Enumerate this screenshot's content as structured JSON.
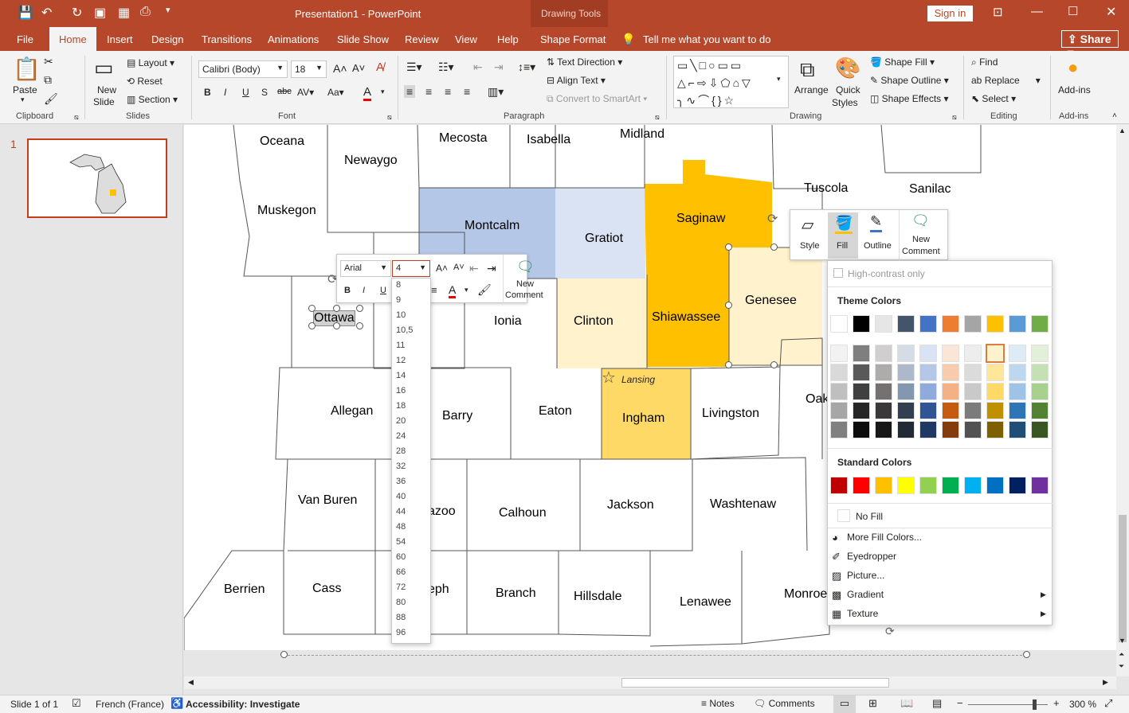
{
  "title": {
    "app": "Presentation1  -  PowerPoint",
    "drawing_tools": "Drawing Tools",
    "sign_in": "Sign in"
  },
  "tabs": [
    "File",
    "Home",
    "Insert",
    "Design",
    "Transitions",
    "Animations",
    "Slide Show",
    "Review",
    "View",
    "Help",
    "Shape Format"
  ],
  "tell_me": "Tell me what you want to do",
  "share": "Share",
  "ribbon": {
    "clipboard": {
      "group": "Clipboard",
      "paste": "Paste"
    },
    "slides": {
      "group": "Slides",
      "new_slide_1": "New",
      "new_slide_2": "Slide",
      "layout": "Layout",
      "reset": "Reset",
      "section": "Section"
    },
    "font": {
      "group": "Font",
      "name": "Calibri (Body)",
      "size": "18"
    },
    "paragraph": {
      "group": "Paragraph",
      "text_direction": "Text Direction",
      "align_text": "Align Text",
      "convert": "Convert to SmartArt"
    },
    "drawing": {
      "group": "Drawing",
      "arrange": "Arrange",
      "quick_1": "Quick",
      "quick_2": "Styles",
      "shape_fill": "Shape Fill",
      "shape_outline": "Shape Outline",
      "shape_effects": "Shape Effects"
    },
    "editing": {
      "group": "Editing",
      "find": "Find",
      "replace": "Replace",
      "select": "Select"
    },
    "addins": {
      "group": "Add-ins",
      "label": "Add-ins"
    }
  },
  "slide_number": "1",
  "counties": [
    {
      "name": "Oceana"
    },
    {
      "name": "Newaygo"
    },
    {
      "name": "Mecosta"
    },
    {
      "name": "Isabella"
    },
    {
      "name": "Midland"
    },
    {
      "name": "Tuscola"
    },
    {
      "name": "Sanilac"
    },
    {
      "name": "Muskegon"
    },
    {
      "name": "Montcalm"
    },
    {
      "name": "Gratiot"
    },
    {
      "name": "Saginaw"
    },
    {
      "name": "Ottawa"
    },
    {
      "name": "Ionia"
    },
    {
      "name": "Clinton"
    },
    {
      "name": "Shiawassee"
    },
    {
      "name": "Genesee"
    },
    {
      "name": "Allegan"
    },
    {
      "name": "Barry"
    },
    {
      "name": "Eaton"
    },
    {
      "name": "Ingham"
    },
    {
      "name": "Livingston"
    },
    {
      "name": "Oak"
    },
    {
      "name": "Van Buren"
    },
    {
      "name": "azoo"
    },
    {
      "name": "Calhoun"
    },
    {
      "name": "Jackson"
    },
    {
      "name": "Washtenaw"
    },
    {
      "name": "Berrien"
    },
    {
      "name": "Cass"
    },
    {
      "name": "eph"
    },
    {
      "name": "Branch"
    },
    {
      "name": "Hillsdale"
    },
    {
      "name": "Lenawee"
    },
    {
      "name": "Monroe"
    }
  ],
  "lansing": "Lansing",
  "mini_toolbar": {
    "font": "Arial",
    "size_value": "4",
    "new_comment_1": "New",
    "new_comment_2": "Comment"
  },
  "font_sizes": [
    "8",
    "9",
    "10",
    "10,5",
    "11",
    "12",
    "14",
    "16",
    "18",
    "20",
    "24",
    "28",
    "32",
    "36",
    "40",
    "44",
    "48",
    "54",
    "60",
    "66",
    "72",
    "80",
    "88",
    "96"
  ],
  "style_toolbar": {
    "style": "Style",
    "fill": "Fill",
    "outline": "Outline",
    "new_comment_1": "New",
    "new_comment_2": "Comment"
  },
  "fill_menu": {
    "high_contrast": "High-contrast only",
    "theme_colors": "Theme Colors",
    "standard_colors": "Standard Colors",
    "no_fill": "No Fill",
    "more": "More Fill Colors...",
    "eyedropper": "Eyedropper",
    "picture": "Picture...",
    "gradient": "Gradient",
    "texture": "Texture",
    "theme_top": [
      "#ffffff",
      "#000000",
      "#e7e6e6",
      "#44546a",
      "#4472c4",
      "#ed7d31",
      "#a5a5a5",
      "#ffc000",
      "#5b9bd5",
      "#70ad47"
    ],
    "standard": [
      "#c00000",
      "#ff0000",
      "#ffc000",
      "#ffff00",
      "#92d050",
      "#00b050",
      "#00b0f0",
      "#0070c0",
      "#002060",
      "#7030a0"
    ]
  },
  "status": {
    "slide": "Slide 1 of 1",
    "language": "French (France)",
    "accessibility": "Accessibility: Investigate",
    "notes": "Notes",
    "comments": "Comments",
    "zoom": "300 %"
  },
  "colors": {
    "accent": "#b7472a",
    "saginaw": "#ffc000",
    "montcalm": "#b4c7e7",
    "gratiot": "#dae3f3",
    "clinton": "#fff2cc",
    "ingham": "#ffd966"
  }
}
